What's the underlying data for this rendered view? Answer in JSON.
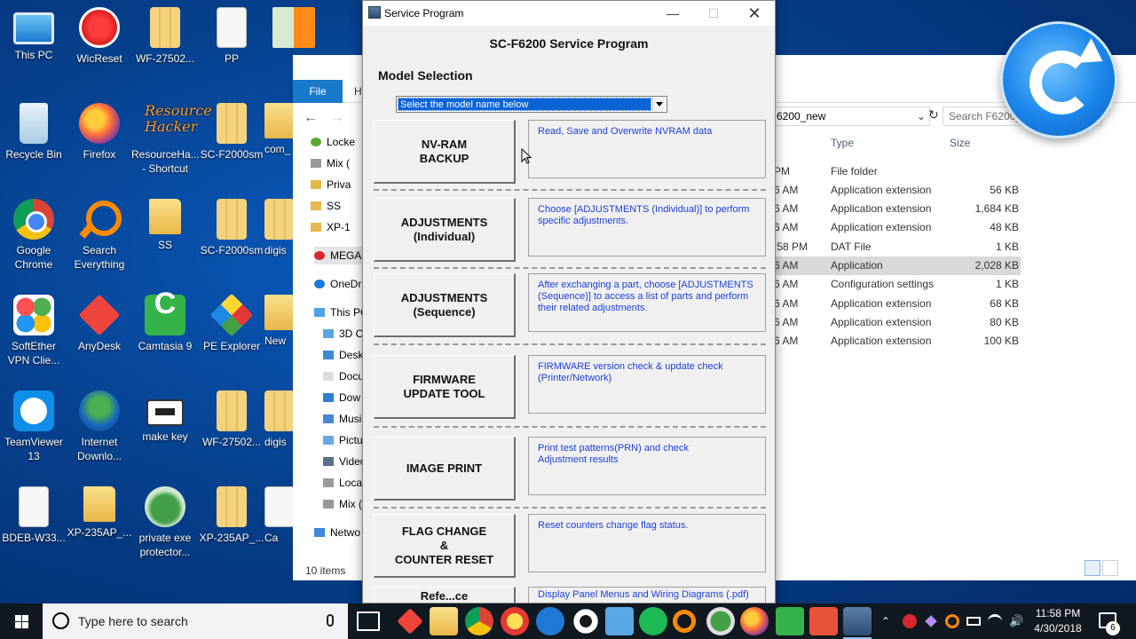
{
  "desktop": {
    "icons": [
      {
        "label": "This PC"
      },
      {
        "label": "WicReset"
      },
      {
        "label": "WF-27502..."
      },
      {
        "label": "PP"
      },
      {
        "label": "Recycle Bin"
      },
      {
        "label": "Firefox"
      },
      {
        "label": "ResourceHa... - Shortcut"
      },
      {
        "label": "SC-F2000sm"
      },
      {
        "label": "Google Chrome"
      },
      {
        "label": "Search Everything"
      },
      {
        "label": "SS"
      },
      {
        "label": "SC-F2000sm"
      },
      {
        "label": "SoftEther VPN Clie..."
      },
      {
        "label": "AnyDesk"
      },
      {
        "label": "Camtasia 9"
      },
      {
        "label": "PE Explorer"
      },
      {
        "label": "TeamViewer 13"
      },
      {
        "label": "Internet Downlo..."
      },
      {
        "label": "make key"
      },
      {
        "label": "WF-27502..."
      },
      {
        "label": "BDEB-W33..."
      },
      {
        "label": "XP-235AP_..."
      },
      {
        "label": "private exe protector..."
      },
      {
        "label": "XP-235AP_..."
      }
    ],
    "partial_labels": [
      "com_",
      "digis",
      "New",
      "digis",
      "Ca"
    ],
    "resource_hacker_art": "Resource Hacker"
  },
  "explorer": {
    "file_tab": "File",
    "home_tab_partial": "Ho",
    "path": "6200_new",
    "search_placeholder": "Search F6200_",
    "columns": {
      "type": "Type",
      "size": "Size"
    },
    "nav": [
      {
        "label": "Locke"
      },
      {
        "label": "Mix ("
      },
      {
        "label": "Priva"
      },
      {
        "label": "SS"
      },
      {
        "label": "XP-1"
      },
      {
        "label": "MEGA"
      },
      {
        "label": "OneDr"
      },
      {
        "label": "This PC"
      },
      {
        "label": "3D O"
      },
      {
        "label": "Desk"
      },
      {
        "label": "Docu"
      },
      {
        "label": "Dow"
      },
      {
        "label": "Musi"
      },
      {
        "label": "Pictu"
      },
      {
        "label": "Video"
      },
      {
        "label": "Local"
      },
      {
        "label": "Mix ("
      },
      {
        "label": "Netwo"
      }
    ],
    "rows": [
      {
        "time": "PM",
        "type": "File folder",
        "size": ""
      },
      {
        "time": "6 AM",
        "type": "Application extension",
        "size": "56 KB"
      },
      {
        "time": "6 AM",
        "type": "Application extension",
        "size": "1,684 KB"
      },
      {
        "time": "6 AM",
        "type": "Application extension",
        "size": "48 KB"
      },
      {
        "time": ":58 PM",
        "type": "DAT File",
        "size": "1 KB"
      },
      {
        "time": "6 AM",
        "type": "Application",
        "size": "2,028 KB",
        "selected": true
      },
      {
        "time": "6 AM",
        "type": "Configuration settings",
        "size": "1 KB"
      },
      {
        "time": "6 AM",
        "type": "Application extension",
        "size": "68 KB"
      },
      {
        "time": "6 AM",
        "type": "Application extension",
        "size": "80 KB"
      },
      {
        "time": "6 AM",
        "type": "Application extension",
        "size": "100 KB"
      }
    ],
    "status": "10 items"
  },
  "service_program": {
    "window_title": "Service Program",
    "program_title": "SC-F6200 Service Program",
    "model_label": "Model Selection",
    "model_select_value": "Select the model name below",
    "functions": [
      {
        "button": "NV-RAM\nBACKUP",
        "description": "Read, Save and Overwrite NVRAM data"
      },
      {
        "button": "ADJUSTMENTS\n(Individual)",
        "description": "Choose [ADJUSTMENTS (Individual)] to perform\nspecific adjustments."
      },
      {
        "button": "ADJUSTMENTS\n(Sequence)",
        "description": "After exchanging a part, choose [ADJUSTMENTS\n(Sequence)] to access a list of parts and perform\ntheir related adjustments."
      },
      {
        "button": "FIRMWARE\nUPDATE TOOL",
        "description": "FIRMWARE version check & update check\n(Printer/Network)"
      },
      {
        "button": "IMAGE PRINT",
        "description": "Print test patterns(PRN) and check\n Adjustment results"
      },
      {
        "button": "FLAG CHANGE\n&\nCOUNTER RESET",
        "description": "Reset counters  change flag status."
      },
      {
        "button": "Refe...ce",
        "description": "Display Panel Menus and Wiring Diagrams (.pdf)"
      }
    ]
  },
  "taskbar": {
    "search_placeholder": "Type here to search",
    "time": "11:58 PM",
    "date": "4/30/2018",
    "notification_count": "6"
  }
}
